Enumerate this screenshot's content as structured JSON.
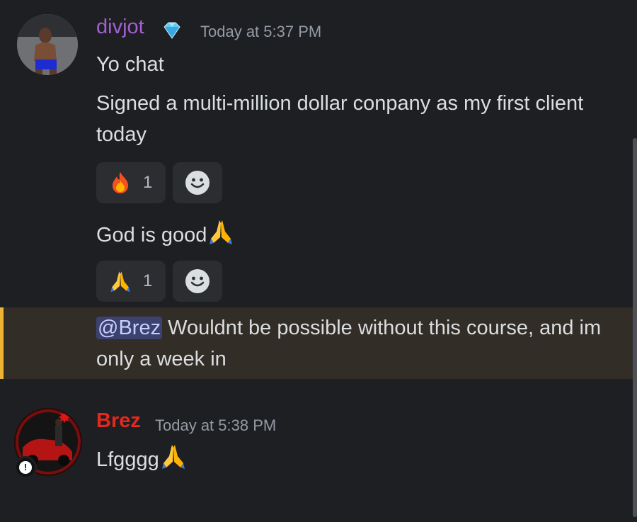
{
  "messages": {
    "divjot": {
      "username": "divjot",
      "timestamp": "Today at 5:37 PM",
      "badge_icon": "diamond-icon",
      "lines": [
        "Yo chat",
        "Signed a multi-million dollar conpany as my first client today",
        "God is good"
      ],
      "reactions": [
        {
          "emoji": "fire-emoji",
          "count": "1"
        },
        {
          "emoji": "folded-hands-emoji",
          "count": "1"
        }
      ],
      "mention_message": {
        "mention": "@Brez",
        "text": " Wouldnt be possible without this course, and im only a week in"
      }
    },
    "brez": {
      "username": "Brez",
      "timestamp": "Today at 5:38 PM",
      "line": "Lfgggg"
    }
  },
  "colors": {
    "background": "#1e1f22",
    "divjot_name": "#a360cf",
    "brez_name": "#e5281e",
    "mention_highlight": "#322d26",
    "mention_bar": "#f0b232"
  }
}
